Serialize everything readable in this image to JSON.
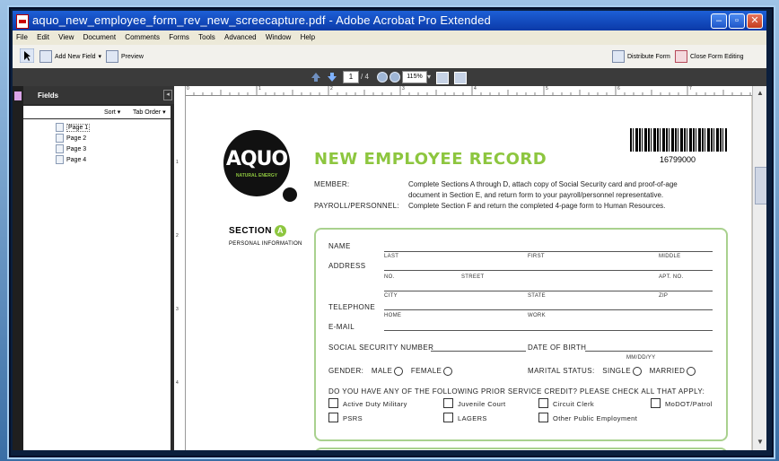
{
  "window": {
    "title": "aquo_new_employee_form_rev_new_screecapture.pdf - Adobe Acrobat Pro Extended",
    "controls": [
      "minimize",
      "maximize",
      "close"
    ]
  },
  "menu": [
    "File",
    "Edit",
    "View",
    "Document",
    "Comments",
    "Forms",
    "Tools",
    "Advanced",
    "Window",
    "Help"
  ],
  "toolbar": {
    "add_field": "Add New Field",
    "preview": "Preview",
    "distribute": "Distribute Form",
    "close_editing": "Close Form Editing"
  },
  "nav": {
    "page_current": "1",
    "page_total": "/ 4",
    "zoom": "115%"
  },
  "fields_panel": {
    "title": "Fields",
    "sort": "Sort",
    "tab_order": "Tab Order",
    "pages": [
      "Page 1",
      "Page 2",
      "Page 3",
      "Page 4"
    ]
  },
  "doc": {
    "logo_text": "AQUO",
    "logo_sub": "NATURAL ENERGY",
    "title": "NEW EMPLOYEE RECORD",
    "barcode_number": "16799000",
    "member_label": "MEMBER:",
    "member_text_1": "Complete Sections A through D, attach copy of Social Security card and proof-of-age",
    "member_text_2": "document in Section E, and return form to your payroll/personnel representative.",
    "payroll_label": "PAYROLL/PERSONNEL:",
    "payroll_text": "Complete Section F and return the completed 4-page form to Human Resources.",
    "section_label": "SECTION",
    "section_letter": "A",
    "section_sub": "PERSONAL INFORMATION",
    "name": "NAME",
    "last": "LAST",
    "first": "FIRST",
    "middle": "MIDDLE",
    "address": "ADDRESS",
    "no": "NO.",
    "street": "STREET",
    "apt": "APT. NO.",
    "city": "CITY",
    "state": "STATE",
    "zip": "ZIP",
    "telephone": "TELEPHONE",
    "home": "HOME",
    "work": "WORK",
    "email": "E-MAIL",
    "ssn": "SOCIAL SECURITY NUMBER",
    "dob": "DATE OF BIRTH",
    "dob_format": "MM/DD/YY",
    "gender": "GENDER:",
    "male": "MALE",
    "female": "FEMALE",
    "marital": "MARITAL STATUS:",
    "single": "SINGLE",
    "married": "MARRIED",
    "prior_service": "DO YOU HAVE ANY OF THE FOLLOWING PRIOR SERVICE CREDIT? PLEASE CHECK ALL THAT APPLY:",
    "checkboxes": [
      "Active Duty Military",
      "Juvenile Court",
      "Circuit Clerk",
      "MoDOT/Patrol",
      "PSRS",
      "LAGERS",
      "Other Public Employment"
    ]
  },
  "ruler": {
    "h": [
      "0",
      "1",
      "2",
      "3",
      "4",
      "5",
      "6",
      "7"
    ],
    "v": [
      "1",
      "2",
      "3",
      "4"
    ]
  }
}
